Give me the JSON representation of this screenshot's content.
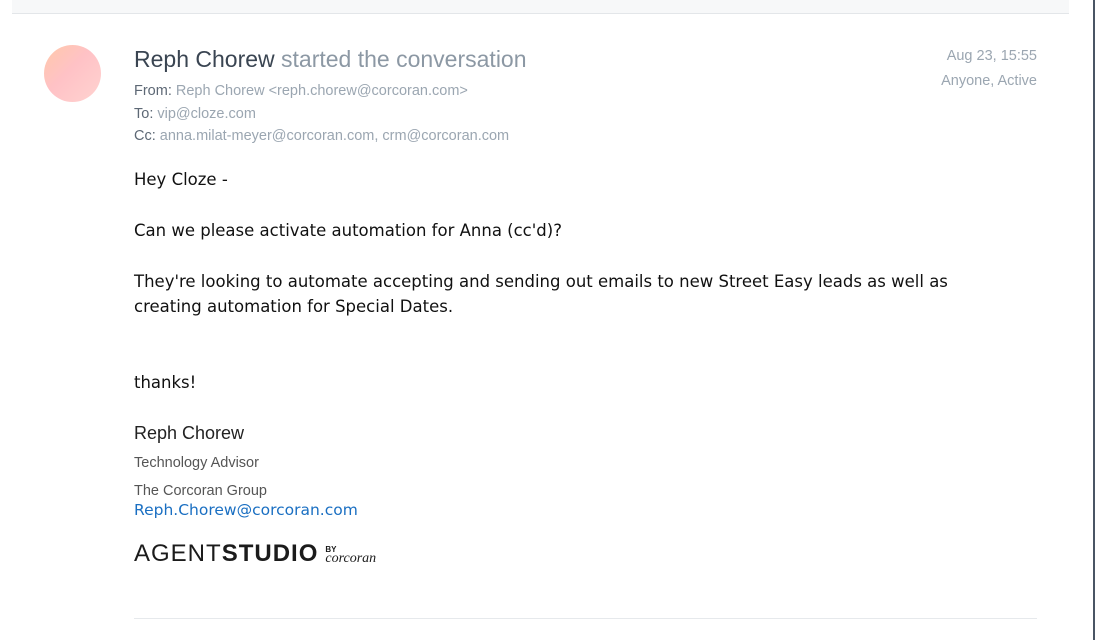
{
  "message": {
    "sender_name": "Reph Chorew",
    "action_text": "started the conversation",
    "date": "Aug 23, 15:55",
    "visibility": "Anyone, Active",
    "from_label": "From:",
    "from_value": "Reph Chorew <reph.chorew@corcoran.com>",
    "to_label": "To:",
    "to_value": "vip@cloze.com",
    "cc_label": "Cc:",
    "cc_value": "anna.milat-meyer@corcoran.com, crm@corcoran.com"
  },
  "body": {
    "greeting": "Hey Cloze -",
    "paragraph1": "Can we please activate automation for Anna (cc'd)?",
    "paragraph2": "They're looking to automate accepting and sending out emails to new Street Easy leads as well as creating automation for Special Dates.",
    "closing": "thanks!"
  },
  "signature": {
    "name": "Reph Chorew",
    "title": "Technology Advisor",
    "company": "The Corcoran Group",
    "email": "Reph.Chorew@corcoran.com",
    "logo": {
      "agent": "AGENT",
      "studio": "STUDIO",
      "by": "BY",
      "brand": "corcoran"
    }
  }
}
